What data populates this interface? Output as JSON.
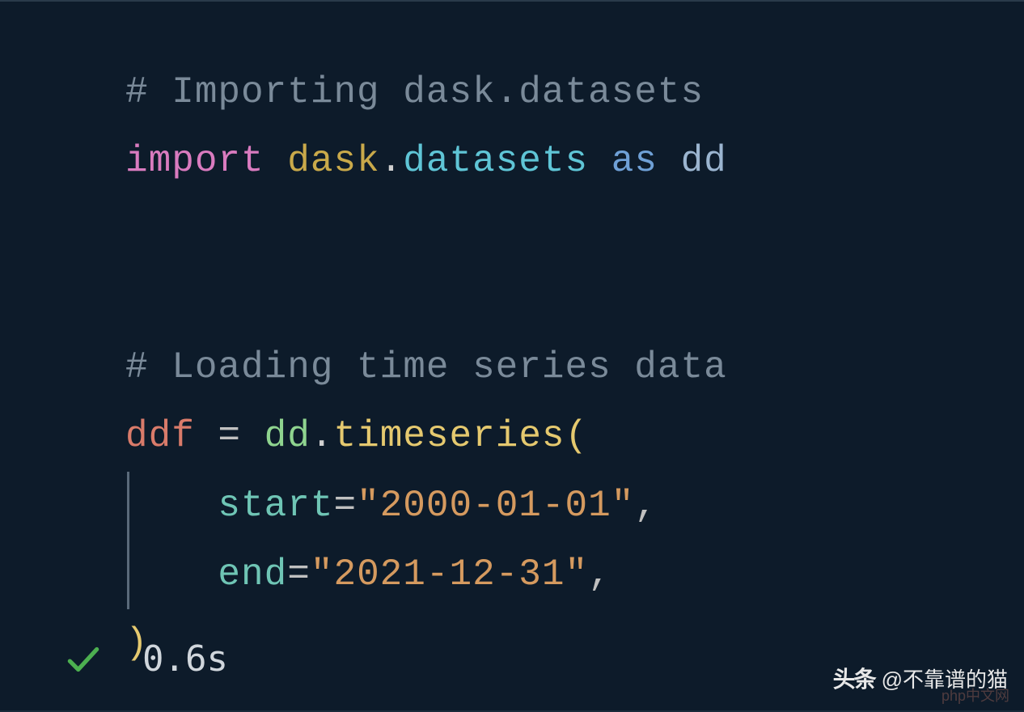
{
  "code": {
    "comment1": "# Importing dask.datasets",
    "import_kw": "import",
    "module_left": "dask",
    "module_dot": ".",
    "module_right": "datasets",
    "as_kw": "as",
    "alias": "dd",
    "comment2": "# Loading time series data",
    "var": "ddf",
    "assign": " = ",
    "obj": "dd",
    "obj_dot": ".",
    "func": "timeseries",
    "lparen": "(",
    "param1": "start",
    "eq1": "=",
    "val1": "\"2000-01-01\"",
    "comma1": ",",
    "param2": "end",
    "eq2": "=",
    "val2": "\"2021-12-31\"",
    "comma2": ",",
    "rparen": ")"
  },
  "status": {
    "time": "0.6s"
  },
  "attribution": {
    "label": "头条",
    "handle": "@不靠谱的猫"
  },
  "watermark": "php中文网"
}
